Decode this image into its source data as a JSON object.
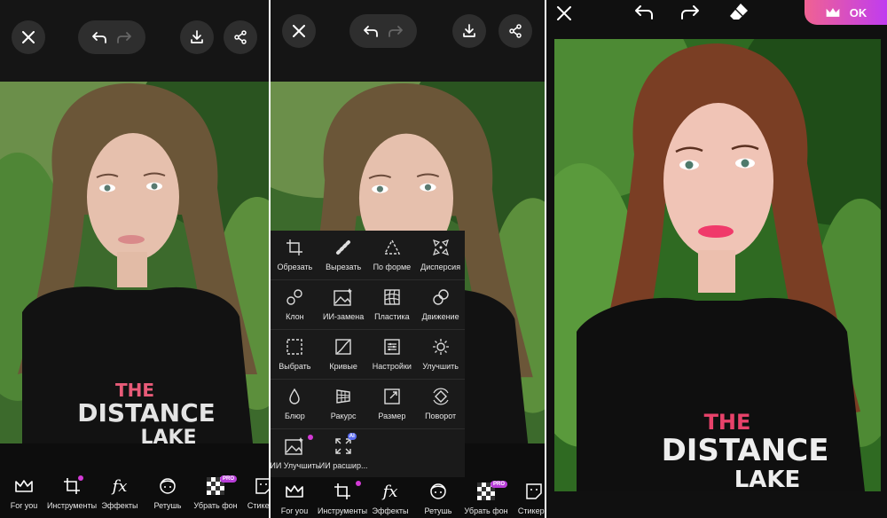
{
  "panel1": {
    "bottom_tools": [
      {
        "label": "For you",
        "icon": "crown-icon"
      },
      {
        "label": "Инструменты",
        "icon": "crop-icon"
      },
      {
        "label": "Эффекты",
        "icon": "fx-icon",
        "glyph": "fx"
      },
      {
        "label": "Ретушь",
        "icon": "face-icon"
      },
      {
        "label": "Убрать фон",
        "icon": "remove-bg-icon",
        "badge": "PRO"
      },
      {
        "label": "Стикеры",
        "icon": "sticker-icon"
      }
    ]
  },
  "panel2": {
    "tools_menu": [
      {
        "label": "Обрезать",
        "icon": "crop-icon"
      },
      {
        "label": "Вырезать",
        "icon": "cutout-icon"
      },
      {
        "label": "По форме",
        "icon": "shape-triangle-icon"
      },
      {
        "label": "Дисперсия",
        "icon": "dispersion-icon"
      },
      {
        "label": "Клон",
        "icon": "clone-icon"
      },
      {
        "label": "ИИ-замена",
        "icon": "ai-replace-icon"
      },
      {
        "label": "Пластика",
        "icon": "warp-grid-icon"
      },
      {
        "label": "Движение",
        "icon": "motion-icon"
      },
      {
        "label": "Выбрать",
        "icon": "select-icon"
      },
      {
        "label": "Кривые",
        "icon": "curves-icon"
      },
      {
        "label": "Настройки",
        "icon": "adjust-icon"
      },
      {
        "label": "Улучшить",
        "icon": "enhance-icon"
      },
      {
        "label": "Блюр",
        "icon": "blur-drop-icon"
      },
      {
        "label": "Ракурс",
        "icon": "perspective-icon"
      },
      {
        "label": "Размер",
        "icon": "resize-icon"
      },
      {
        "label": "Поворот",
        "icon": "rotate-icon"
      },
      {
        "label": "ИИ Улучшить",
        "icon": "ai-enhance-icon"
      },
      {
        "label": "ИИ расшир...",
        "icon": "ai-expand-icon",
        "badge": "AI"
      }
    ],
    "bottom_tools": [
      {
        "label": "For you",
        "icon": "crown-icon"
      },
      {
        "label": "Инструменты",
        "icon": "crop-icon"
      },
      {
        "label": "Эффекты",
        "icon": "fx-icon",
        "glyph": "fx"
      },
      {
        "label": "Ретушь",
        "icon": "face-icon"
      },
      {
        "label": "Убрать фон",
        "icon": "remove-bg-icon",
        "badge": "PRO"
      },
      {
        "label": "Стикеры",
        "icon": "sticker-icon"
      }
    ]
  },
  "panel3": {
    "ok_label": "OK"
  },
  "photo_text": {
    "shirt_line1": "THE",
    "shirt_line2": "DISTANCE",
    "shirt_line3": "LAKE"
  },
  "colors": {
    "accent_pink": "#f06292",
    "accent_purple": "#c03cf0",
    "badge_dot": "#d33ad6"
  }
}
